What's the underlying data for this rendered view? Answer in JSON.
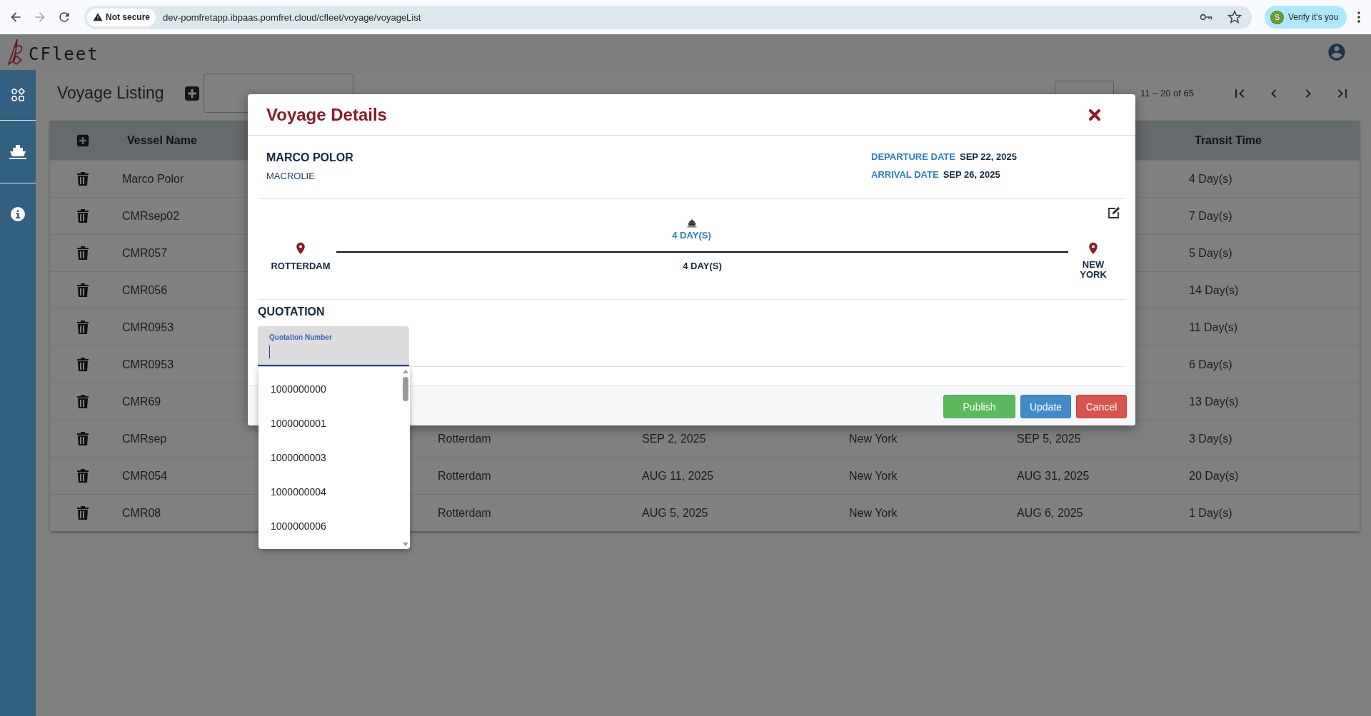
{
  "browser": {
    "security": "Not secure",
    "url": "dev-pomfretapp.ibpaas.pomfret.cloud/cfleet/voyage/voyageList",
    "profile_initial": "S",
    "profile_chip": "Verify it's you"
  },
  "app": {
    "logo": "CFleet"
  },
  "page": {
    "title": "Voyage Listing",
    "paginator": {
      "range": "11 – 20 of 65"
    }
  },
  "table": {
    "columns": [
      "Vessel Name",
      "Transit Time"
    ],
    "rows": [
      {
        "vessel": "Marco Polor",
        "transit": "4 Day(s)"
      },
      {
        "vessel": "CMRsep02",
        "transit": "7 Day(s)"
      },
      {
        "vessel": "CMR057",
        "transit": "5 Day(s)"
      },
      {
        "vessel": "CMR056",
        "transit": "14 Day(s)"
      },
      {
        "vessel": "CMR0953",
        "transit": "11 Day(s)"
      },
      {
        "vessel": "CMR0953",
        "transit": "6 Day(s)"
      },
      {
        "vessel": "CMR69",
        "transit": "13 Day(s)"
      },
      {
        "vessel": "CMRsep",
        "origin": "Rotterdam",
        "departure": "SEP 2, 2025",
        "destination": "New York",
        "arrival": "SEP 5, 2025",
        "transit": "3 Day(s)"
      },
      {
        "vessel": "CMR054",
        "origin": "Rotterdam",
        "departure": "AUG 11, 2025",
        "destination": "New York",
        "arrival": "AUG 31, 2025",
        "transit": "20 Day(s)"
      },
      {
        "vessel": "CMR08",
        "origin": "Rotterdam",
        "departure": "AUG 5, 2025",
        "destination": "New York",
        "arrival": "AUG 6, 2025",
        "transit": "1 Day(s)"
      }
    ]
  },
  "modal": {
    "title": "Voyage Details",
    "vessel": "MARCO POLOR",
    "operator": "MACROLIE",
    "dates": [
      {
        "label": "DEPARTURE DATE",
        "value": "SEP 22, 2025"
      },
      {
        "label": "ARRIVAL DATE",
        "value": "SEP 26, 2025"
      }
    ],
    "route": {
      "origin": "ROTTERDAM",
      "destination": "NEW YORK",
      "duration_top": "4 DAY(S)",
      "duration_line": "4 DAY(S)"
    },
    "quotation": {
      "heading": "QUOTATION",
      "field": {
        "label": "Quotation Number",
        "focused": true
      },
      "options": [
        "1000000000",
        "1000000001",
        "1000000003",
        "1000000004",
        "1000000006"
      ]
    },
    "buttons": [
      {
        "label": "Publish",
        "kind": "success"
      },
      {
        "label": "Update",
        "kind": "primary"
      },
      {
        "label": "Cancel",
        "kind": "danger"
      }
    ]
  }
}
